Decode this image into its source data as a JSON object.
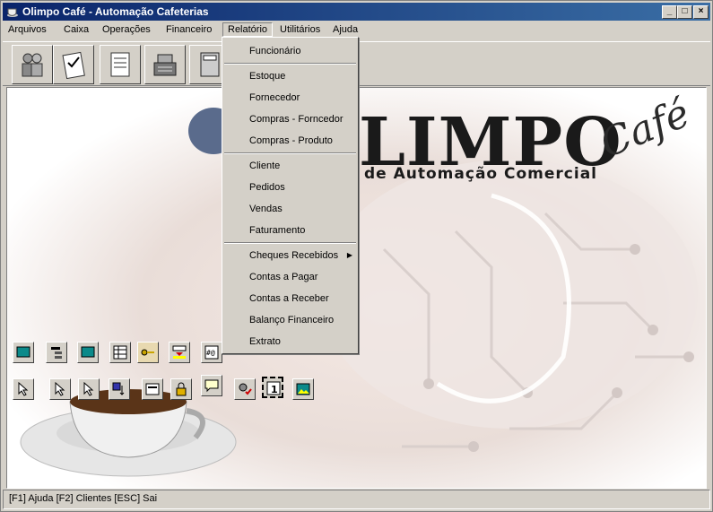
{
  "window": {
    "title": "Olimpo Café - Automação Cafeterias",
    "controls": {
      "minimize": "_",
      "maximize": "□",
      "close": "×"
    }
  },
  "menubar": {
    "items": [
      {
        "label": "Arquivos"
      },
      {
        "label": "Caixa"
      },
      {
        "label": "Operações"
      },
      {
        "label": "Financeiro"
      },
      {
        "label": "Relatório"
      },
      {
        "label": "Utilitários"
      },
      {
        "label": "Ajuda"
      }
    ]
  },
  "toolbar": {
    "icons": [
      "users-icon",
      "checklist-icon",
      "report-icon",
      "cash-register-icon",
      "calculator-icon"
    ]
  },
  "relatorio_menu": {
    "items": [
      {
        "label": "Funcionário"
      },
      {
        "label": "Estoque"
      },
      {
        "label": "Fornecedor"
      },
      {
        "label": "Compras - Forncedor"
      },
      {
        "label": "Compras - Produto"
      },
      {
        "label": "Cliente"
      },
      {
        "label": "Pedidos"
      },
      {
        "label": "Vendas"
      },
      {
        "label": "Faturamento"
      },
      {
        "label": "Cheques Recebidos"
      },
      {
        "label": "Contas a Pagar"
      },
      {
        "label": "Contas a Receber"
      },
      {
        "label": "Balanço Financeiro"
      },
      {
        "label": "Extrato"
      }
    ],
    "submenu_arrow": "▶"
  },
  "branding": {
    "logo": "LIMPO",
    "cafe": "Café",
    "subtitle": "de Automação Comercial"
  },
  "statusbar": {
    "text": "[F1] Ajuda [F2] Clientes [ESC] Sai"
  },
  "colors": {
    "titlebar_start": "#0a246a",
    "titlebar_end": "#3a6ea5",
    "chrome": "#d4d0c8"
  }
}
